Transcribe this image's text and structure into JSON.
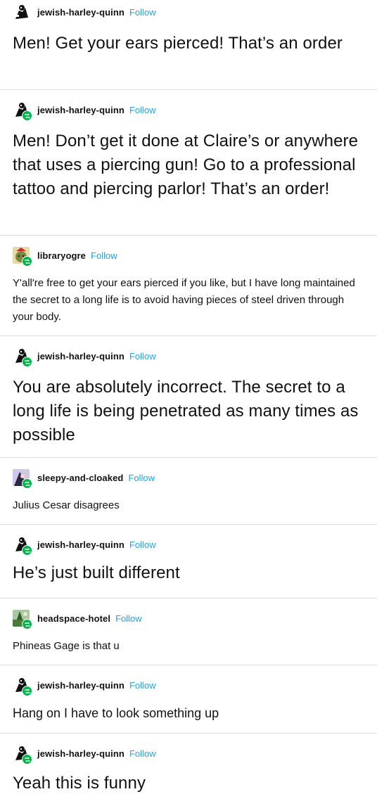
{
  "follow_label": "Follow",
  "colors": {
    "follow": "#1aa7e0",
    "reblog_badge": "#00b44a",
    "divider": "#dcdcdc"
  },
  "posts": [
    {
      "username": "jewish-harley-quinn",
      "text": "Men! Get your ears pierced! That’s an order"
    },
    {
      "username": "jewish-harley-quinn",
      "text": "Men! Don’t get it done at Claire’s or anywhere that uses a piercing gun! Go to a professional tattoo and piercing parlor! That’s an order!"
    },
    {
      "username": "libraryogre",
      "text": "Y'all're free to get your ears pierced if you like, but I have long maintained the secret to a long life is to avoid having pieces of steel driven through your body."
    },
    {
      "username": "jewish-harley-quinn",
      "text": "You are absolutely incorrect. The secret to a long life is being penetrated as many times as possible"
    },
    {
      "username": "sleepy-and-cloaked",
      "text": "Julius Cesar disagrees"
    },
    {
      "username": "jewish-harley-quinn",
      "text": "He’s just built different"
    },
    {
      "username": "headspace-hotel",
      "text": "Phineas Gage is that u"
    },
    {
      "username": "jewish-harley-quinn",
      "text": "Hang on I have to look something up"
    },
    {
      "username": "jewish-harley-quinn",
      "text": "Yeah this is funny"
    }
  ]
}
